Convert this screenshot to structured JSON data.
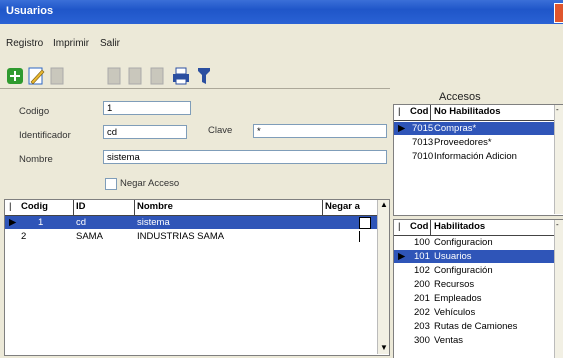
{
  "window": {
    "title": "Usuarios"
  },
  "menu": {
    "registro": "Registro",
    "imprimir": "Imprimir",
    "salir": "Salir"
  },
  "toolbar": {
    "items": [
      {
        "icon": "add-icon",
        "color": "#2f9a2f"
      },
      {
        "icon": "edit-icon",
        "color": "#2d66c3"
      },
      {
        "icon": "disabled-icon",
        "color": "#b8b6aa"
      },
      {
        "icon": "disabled-icon",
        "color": "#b8b6aa"
      },
      {
        "icon": "disabled-icon",
        "color": "#b8b6aa"
      },
      {
        "icon": "print-icon",
        "color": "#2b4fa0"
      },
      {
        "icon": "filter-icon",
        "color": "#2b4fa0"
      }
    ]
  },
  "form": {
    "codigo_label": "Codigo",
    "codigo_value": "1",
    "identificador_label": "Identificador",
    "identificador_value": "cd",
    "clave_label": "Clave",
    "clave_value": "*",
    "nombre_label": "Nombre",
    "nombre_value": "sistema",
    "negar_label": "Negar Acceso"
  },
  "users_table": {
    "headers": [
      "Codig",
      "ID",
      "Nombre",
      "Negar a"
    ],
    "rows": [
      {
        "codigo": "1",
        "id": "cd",
        "nombre": "sistema"
      },
      {
        "codigo": "2",
        "id": "SAMA",
        "nombre": "INDUSTRIAS SAMA"
      }
    ]
  },
  "accesos": {
    "title": "Accesos",
    "no_habilitados": {
      "headers": [
        "Cod",
        "No Habilitados"
      ],
      "rows": [
        {
          "cod": "7015",
          "name": "Compras*"
        },
        {
          "cod": "7013",
          "name": "Proveedores*"
        },
        {
          "cod": "7010",
          "name": "Información Adicion"
        }
      ]
    },
    "habilitados": {
      "headers": [
        "Cod",
        "Habilitados"
      ],
      "rows": [
        {
          "cod": "100",
          "name": "Configuracion"
        },
        {
          "cod": "101",
          "name": "Usuarios"
        },
        {
          "cod": "102",
          "name": "Configuración"
        },
        {
          "cod": "200",
          "name": "Recursos"
        },
        {
          "cod": "201",
          "name": "Empleados"
        },
        {
          "cod": "202",
          "name": "Vehículos"
        },
        {
          "cod": "203",
          "name": "Rutas de Camiones"
        },
        {
          "cod": "300",
          "name": "Ventas"
        }
      ]
    }
  }
}
